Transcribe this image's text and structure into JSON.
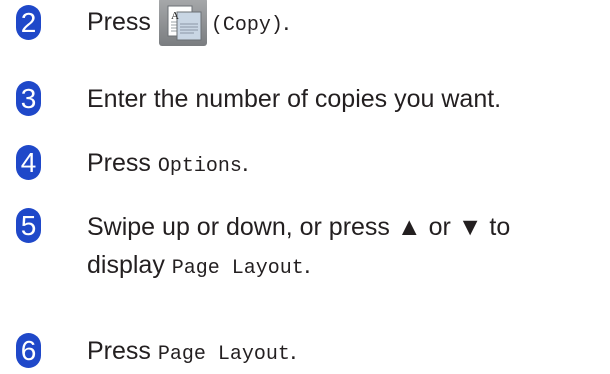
{
  "steps": [
    {
      "number": "2",
      "pre": "Press",
      "icon": "copy-app-icon",
      "icon_letter": "A",
      "code": "(Copy)",
      "post": "."
    },
    {
      "number": "3",
      "text": "Enter the number of copies you want."
    },
    {
      "number": "4",
      "pre": "Press",
      "code": "Options",
      "post": "."
    },
    {
      "number": "5",
      "line1": "Swipe up or down, or press ▲ or ▼ to",
      "line2_pre": "display",
      "line2_code": "Page Layout",
      "line2_post": "."
    },
    {
      "number": "6",
      "pre": "Press",
      "code": "Page Layout",
      "post": "."
    }
  ],
  "colors": {
    "badge": "#1f48c9",
    "text": "#231f20"
  }
}
